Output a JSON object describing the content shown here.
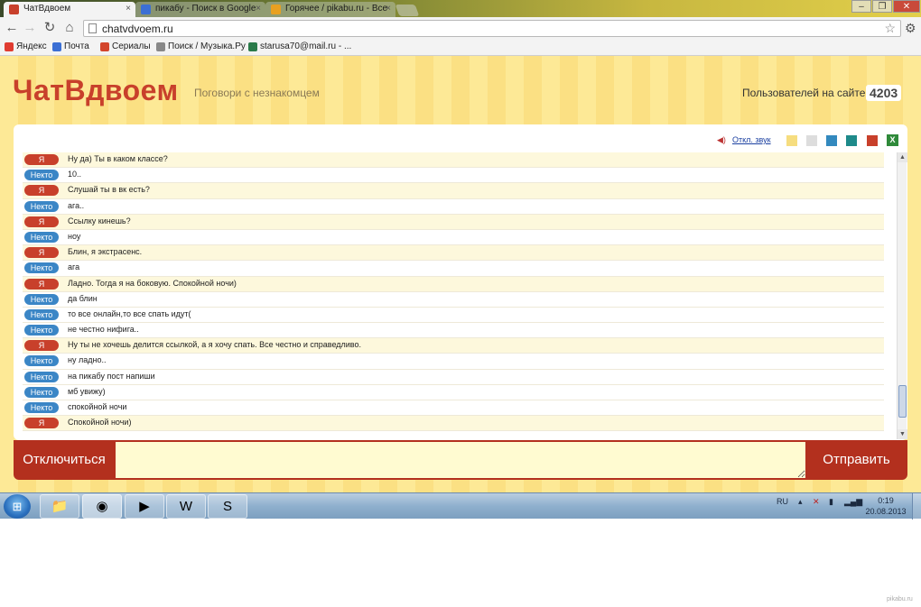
{
  "browser": {
    "tabs": [
      {
        "label": "ЧатВдвоем",
        "active": true
      },
      {
        "label": "пикабу - Поиск в Google",
        "active": false
      },
      {
        "label": "Горячее / pikabu.ru - Все",
        "active": false
      }
    ],
    "tab_close": "×",
    "url": "chatvdvoem.ru",
    "bookmarks": [
      "Яндекс",
      "Почта",
      "Сериалы",
      "Поиск / Музыка.Ру",
      "starusa70@mail.ru - ..."
    ]
  },
  "site": {
    "logo": "ЧатВдвоем",
    "tagline": "Поговори с незнакомцем",
    "users_label": "Пользователей на сайте",
    "users_count": "4203",
    "mute_label": "Откл. звук",
    "swatch_colors": [
      "#f6dd7f",
      "#dddddd",
      "#3389be",
      "#1e8a8a",
      "#c8402b"
    ],
    "disconnect_label": "Отключиться",
    "send_label": "Отправить",
    "message_input_value": ""
  },
  "messages": [
    {
      "who": "Я",
      "side": "me",
      "text": "Ну да) Ты в каком классе?"
    },
    {
      "who": "Некто",
      "side": "stranger",
      "text": "10.."
    },
    {
      "who": "Я",
      "side": "me",
      "text": "Слушай ты в вк есть?"
    },
    {
      "who": "Некто",
      "side": "stranger",
      "text": "ага.."
    },
    {
      "who": "Я",
      "side": "me",
      "text": "Ссылку кинешь?"
    },
    {
      "who": "Некто",
      "side": "stranger",
      "text": "ноу"
    },
    {
      "who": "Я",
      "side": "me",
      "text": "Блин, я экстрасенс."
    },
    {
      "who": "Некто",
      "side": "stranger",
      "text": "ага"
    },
    {
      "who": "Я",
      "side": "me",
      "text": "Ладно. Тогда я на боковую. Спокойной ночи)"
    },
    {
      "who": "Некто",
      "side": "stranger",
      "text": "да блин"
    },
    {
      "who": "Некто",
      "side": "stranger",
      "text": "то все онлайн,то все спать идут("
    },
    {
      "who": "Некто",
      "side": "stranger",
      "text": "не честно нифига.."
    },
    {
      "who": "Я",
      "side": "me",
      "text": "Ну ты не хочешь делится ссылкой, а я хочу спать. Все честно и справедливо."
    },
    {
      "who": "Некто",
      "side": "stranger",
      "text": "ну ладно.."
    },
    {
      "who": "Некто",
      "side": "stranger",
      "text": "на пикабу пост напиши"
    },
    {
      "who": "Некто",
      "side": "stranger",
      "text": "мб увижу)"
    },
    {
      "who": "Некто",
      "side": "stranger",
      "text": "спокойной ночи"
    },
    {
      "who": "Я",
      "side": "me",
      "text": "Спокойной ночи)"
    }
  ],
  "taskbar": {
    "lang": "RU",
    "time": "0:19",
    "date": "20.08.2013"
  },
  "watermark": "pikabu.ru"
}
